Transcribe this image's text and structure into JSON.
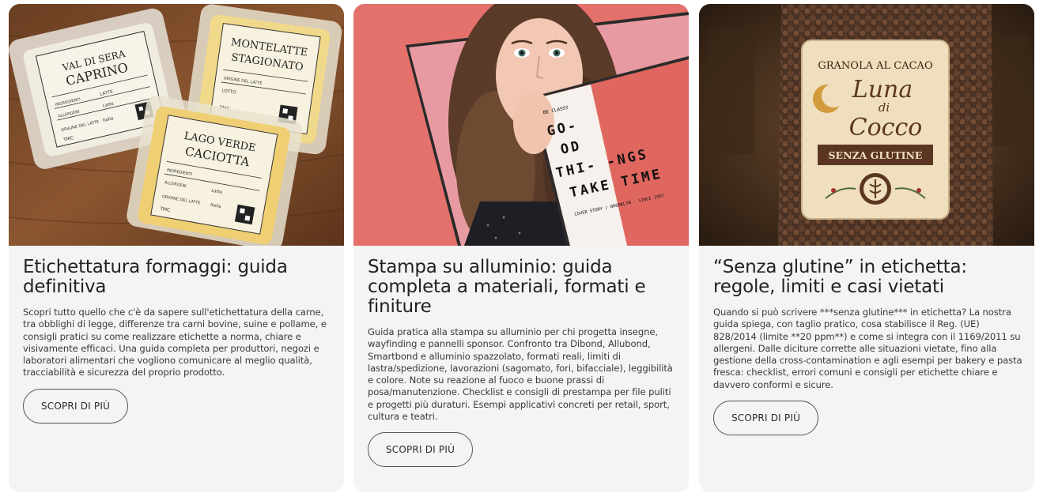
{
  "cards": [
    {
      "image_alt": "cheese-packages-photo",
      "labels": {
        "l1_top": "VAL DI SERA",
        "l1_main": "CAPRINO",
        "l2_top": "MONTELATTE",
        "l2_main": "STAGIONATO",
        "l3_top": "LAGO VERDE",
        "l3_main": "CACIOTTA",
        "ing": "INGREDIENTI",
        "latte": "LATTE",
        "allergeni": "ALLERGENI",
        "latte2": "Latte",
        "origine": "ORIGINE DEL LATTE",
        "italia": "Italia",
        "lotto": "LOTTO",
        "tmc": "TMC"
      },
      "title": "Etichettatura formaggi: guida definitiva",
      "description": "Scopri tutto quello che c'è da sapere sull'etichettatura della carne, tra obblighi di legge, differenze tra carni bovine, suine e pollame, e consigli pratici su come realizzare etichette a norma, chiare e visivamente efficaci. Una guida completa per produttori, negozi e laboratori alimentari che vogliono comunicare al meglio qualità, tracciabilità e sicurezza del proprio prodotto.",
      "button": "SCOPRI DI PIÙ"
    },
    {
      "image_alt": "magazine-cover-photo",
      "labels": {
        "brand": "BE CLASSY",
        "l1": "GO-",
        "l2": "OD",
        "l3": "THI-",
        "l4": "-NGS",
        "l5": "TAKE TIME",
        "sub": "COVER STORY / BROOKLYN · SINCE 1987"
      },
      "title": "Stampa su alluminio: guida completa a materiali, formati e finiture",
      "description": "Guida pratica alla stampa su alluminio per chi progetta insegne, wayfinding e pannelli sponsor. Confronto tra Dibond, Allubond, Smartbond e alluminio spazzolato, formati reali, limiti di lastra/spedizione, lavorazioni (sagomato, fori, bifacciale), leggibilità e colore. Note su reazione al fuoco e buone prassi di posa/manutenzione. Checklist e consigli di prestampa per file puliti e progetti più duraturi. Esempi applicativi concreti per retail, sport, cultura e teatri.",
      "button": "SCOPRI DI PIÙ"
    },
    {
      "image_alt": "granola-bag-photo",
      "labels": {
        "top": "GRANOLA AL CACAO",
        "w1": "Luna",
        "w2": "di",
        "w3": "Cocco",
        "badge": "SENZA GLUTINE"
      },
      "title": "“Senza glutine” in etichetta: regole, limiti e casi vietati",
      "description": "Quando si può scrivere ***senza glutine*** in etichetta? La nostra guida spiega, con taglio pratico, cosa stabilisce il Reg. (UE) 828/2014 (limite **20 ppm**) e come si integra con il 1169/2011 su allergeni. Dalle diciture corrette alle situazioni vietate, fino alla gestione della cross-contamination e agli esempi per bakery e pasta fresca: checklist, errori comuni e consigli per etichette chiare e davvero conformi e sicure.",
      "button": "SCOPRI DI PIÙ"
    }
  ],
  "colors": {
    "card_bg": "#f4f4f4",
    "button_border": "#555555",
    "magazine_coral": "#e0675f",
    "granola_brown": "#5a3622"
  }
}
